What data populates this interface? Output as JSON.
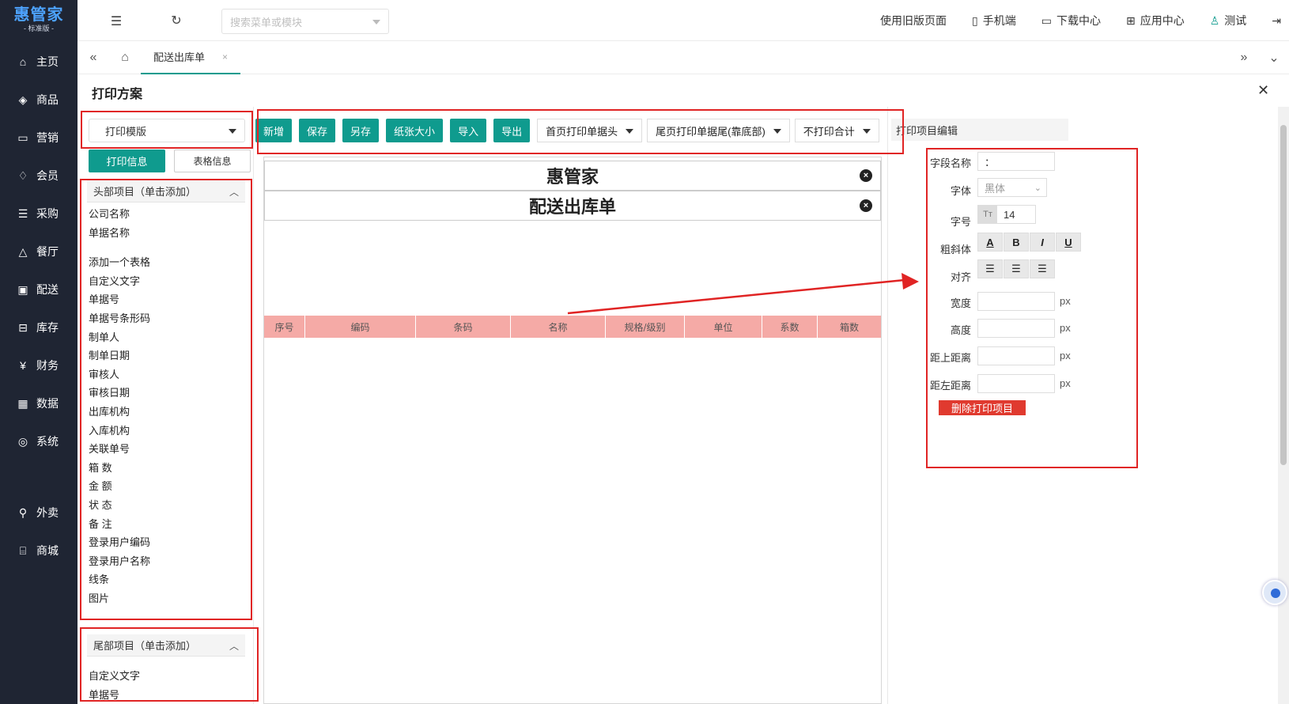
{
  "brand": {
    "name": "惠管家",
    "edition": "- 标准版 -"
  },
  "sidebar": {
    "items": [
      {
        "label": "主页",
        "icon": "home-icon"
      },
      {
        "label": "商品",
        "icon": "box-icon"
      },
      {
        "label": "营销",
        "icon": "chart-icon"
      },
      {
        "label": "会员",
        "icon": "diamond-icon"
      },
      {
        "label": "采购",
        "icon": "clipboard-icon"
      },
      {
        "label": "餐厅",
        "icon": "cloche-icon"
      },
      {
        "label": "配送",
        "icon": "truck-icon"
      },
      {
        "label": "库存",
        "icon": "warehouse-icon"
      },
      {
        "label": "财务",
        "icon": "yen-icon"
      },
      {
        "label": "数据",
        "icon": "data-icon"
      },
      {
        "label": "系统",
        "icon": "settings-icon"
      }
    ],
    "bottom_items": [
      {
        "label": "外卖",
        "icon": "bike-icon"
      },
      {
        "label": "商城",
        "icon": "shop-icon"
      }
    ]
  },
  "topbar": {
    "search_placeholder": "搜索菜单或模块",
    "old_version": "使用旧版页面",
    "mobile": "手机端",
    "download": "下载中心",
    "apps": "应用中心",
    "user": "测试"
  },
  "tabs": {
    "active": "配送出库单",
    "close": "×"
  },
  "page": {
    "title": "打印方案",
    "close": "✕"
  },
  "left": {
    "template_select": "打印模版",
    "btn_print_info": "打印信息",
    "btn_table_info": "表格信息",
    "header_section": "头部项目（单击添加）",
    "header_items": [
      "公司名称",
      "单据名称",
      "",
      "添加一个表格",
      "自定义文字",
      "单据号",
      "单据号条形码",
      "制单人",
      "制单日期",
      "审核人",
      "审核日期",
      "出库机构",
      "入库机构",
      "关联单号",
      "箱 数",
      "金 额",
      "状 态",
      "备 注",
      "登录用户编码",
      "登录用户名称",
      "线条",
      "图片"
    ],
    "footer_section": "尾部项目（单击添加）",
    "footer_items": [
      "自定义文字",
      "单据号"
    ]
  },
  "toolbar": {
    "buttons": [
      "新增",
      "保存",
      "另存",
      "纸张大小",
      "导入",
      "导出"
    ],
    "dropdowns": [
      "首页打印单据头",
      "尾页打印单据尾(靠底部)",
      "不打印合计"
    ]
  },
  "canvas": {
    "company": "惠管家",
    "doc_title": "配送出库单",
    "columns": [
      "序号",
      "编码",
      "条码",
      "名称",
      "规格/级别",
      "单位",
      "系数",
      "箱数"
    ]
  },
  "editor": {
    "title": "打印项目编辑",
    "field_name_label": "字段名称",
    "field_name_value": "：",
    "font_label": "字体",
    "font_value": "黑体",
    "size_label": "字号",
    "size_value": "14",
    "style_label": "粗斜体",
    "style_buttons": [
      "A",
      "B",
      "I",
      "U"
    ],
    "align_label": "对齐",
    "width_label": "宽度",
    "height_label": "高度",
    "top_label": "距上距离",
    "left_label": "距左距离",
    "unit": "px",
    "delete_button": "删除打印项目"
  },
  "colors": {
    "accent": "#0f9b8e",
    "sidebar": "#1f2533",
    "highlight": "#e02424",
    "table_header": "#f5aaa6",
    "delete": "#e03a2f"
  }
}
